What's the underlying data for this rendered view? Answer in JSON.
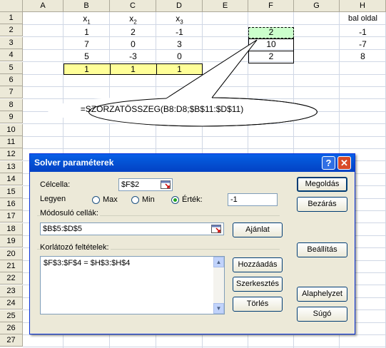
{
  "sheet": {
    "columns": [
      "A",
      "B",
      "C",
      "D",
      "E",
      "F",
      "G",
      "H"
    ],
    "rows": [
      "1",
      "2",
      "3",
      "4",
      "5",
      "6",
      "7",
      "8",
      "9",
      "10",
      "11",
      "12",
      "13",
      "14",
      "15",
      "16",
      "17",
      "18",
      "19",
      "20",
      "21",
      "22",
      "23",
      "24",
      "25",
      "26",
      "27"
    ],
    "headers": {
      "B1": "x1",
      "C1": "x2",
      "D1": "x3",
      "H1": "bal oldal"
    },
    "matrix": [
      [
        "1",
        "2",
        "-1"
      ],
      [
        "7",
        "0",
        "3"
      ],
      [
        "5",
        "-3",
        "0"
      ]
    ],
    "yellow_row": [
      "1",
      "1",
      "1"
    ],
    "f_values": [
      "2",
      "10",
      "2"
    ],
    "h_values": [
      "-1",
      "-7",
      "8"
    ]
  },
  "callout": {
    "formula": "=SZORZATÖSSZEG(B8:D8;$B$11:$D$11)"
  },
  "dialog": {
    "title": "Solver paraméterek",
    "help_glyph": "?",
    "close_glyph": "✕",
    "target_label": "Célcella:",
    "target_value": "$F$2",
    "equal_label": "Legyen",
    "opt_max": "Max",
    "opt_min": "Min",
    "opt_value": "Érték:",
    "value_field": "-1",
    "changing_label": "Módosuló cellák:",
    "changing_value": "$B$5:$D$5",
    "guess_button": "Ajánlat",
    "constraints_label": "Korlátozó feltételek:",
    "constraints": [
      "$F$3:$F$4 = $H$3:$H$4"
    ],
    "add_button": "Hozzáadás",
    "edit_button": "Szerkesztés",
    "delete_button": "Törlés",
    "solve_button": "Megoldás",
    "close_button": "Bezárás",
    "options_button": "Beállítás",
    "reset_button": "Alaphelyzet",
    "help_button": "Súgó"
  }
}
